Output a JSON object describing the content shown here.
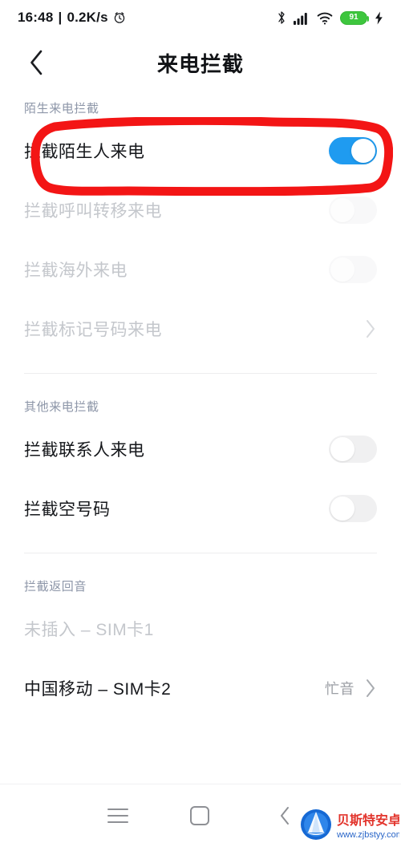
{
  "status_bar": {
    "time": "16:48",
    "separator": "|",
    "network_speed": "0.2K/s",
    "alarm_icon": "alarm-clock-icon",
    "bluetooth_icon": "bluetooth-icon",
    "signal_icon": "cellular-signal-icon",
    "wifi_icon": "wifi-icon",
    "battery_level": "91",
    "charging_icon": "charging-bolt-icon"
  },
  "app_bar": {
    "back_icon": "chevron-left-icon",
    "title": "来电拦截"
  },
  "groups": [
    {
      "title": "陌生来电拦截",
      "rows": [
        {
          "label": "拦截陌生人来电",
          "control": "toggle",
          "state": "on",
          "disabled": false,
          "highlighted": true
        },
        {
          "label": "拦截呼叫转移来电",
          "control": "toggle",
          "state": "off",
          "disabled": true
        },
        {
          "label": "拦截海外来电",
          "control": "toggle",
          "state": "off",
          "disabled": true
        },
        {
          "label": "拦截标记号码来电",
          "control": "chevron",
          "disabled": true
        }
      ]
    },
    {
      "title": "其他来电拦截",
      "rows": [
        {
          "label": "拦截联系人来电",
          "control": "toggle",
          "state": "off",
          "disabled": false
        },
        {
          "label": "拦截空号码",
          "control": "toggle",
          "state": "off",
          "disabled": false
        }
      ]
    },
    {
      "title": "拦截返回音",
      "rows": [
        {
          "label": "未插入 – SIM卡1",
          "control": "none",
          "disabled": true
        },
        {
          "label": "中国移动 – SIM卡2",
          "control": "chevron",
          "value": "忙音",
          "disabled": false
        }
      ]
    }
  ],
  "annotation": {
    "shape": "hand-drawn-rounded-rectangle",
    "color": "#f31515",
    "target": "拦截陌生人来电"
  },
  "nav_bar": {
    "menu_icon": "hamburger-menu-icon",
    "home_icon": "home-square-icon",
    "back_icon": "chevron-left-icon"
  },
  "watermark": {
    "site_name": "贝斯特安卓网",
    "url": "www.zjbstyy.com",
    "logo_icon": "shell-logo-icon",
    "text_color": "#e2342c",
    "url_color": "#2a66c8",
    "logo_color": "#1669d4"
  },
  "colors": {
    "toggle_on": "#1f9bf0",
    "toggle_off_track": "#f0f0f1",
    "group_title": "#8d96a8",
    "label": "#15171b",
    "label_disabled": "#c4c7cc",
    "battery_green": "#3ec63e"
  }
}
